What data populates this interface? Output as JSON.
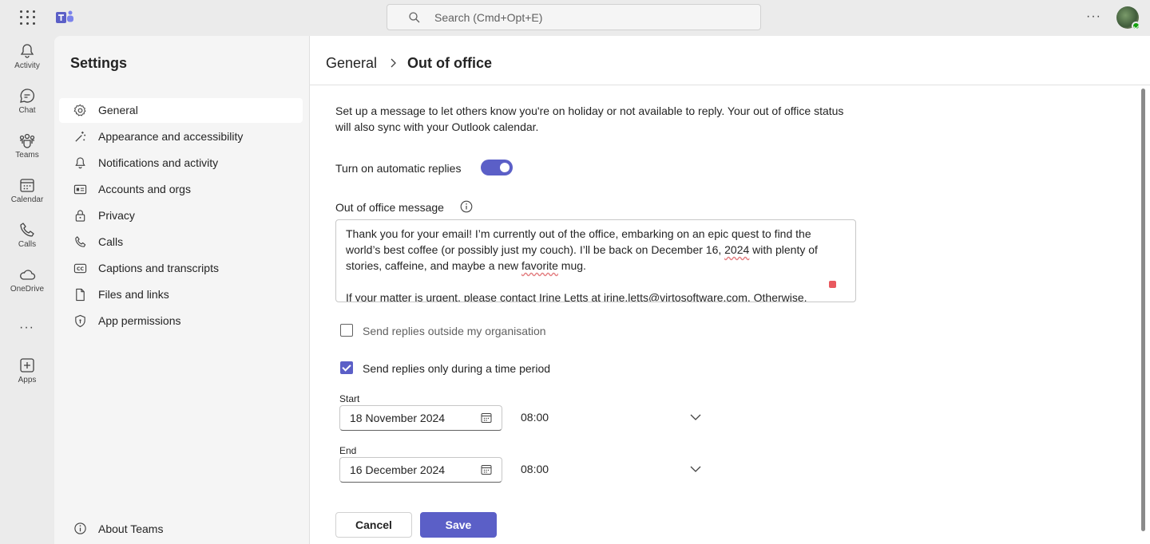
{
  "topbar": {
    "search_placeholder": "Search (Cmd+Opt+E)",
    "more_label": "···"
  },
  "rail": {
    "items": [
      {
        "label": "Activity",
        "icon": "bell-icon"
      },
      {
        "label": "Chat",
        "icon": "chat-icon"
      },
      {
        "label": "Teams",
        "icon": "teams-icon"
      },
      {
        "label": "Calendar",
        "icon": "calendar-icon"
      },
      {
        "label": "Calls",
        "icon": "phone-icon"
      },
      {
        "label": "OneDrive",
        "icon": "cloud-icon"
      },
      {
        "label": "Apps",
        "icon": "add-app-icon"
      }
    ],
    "more_label": "···"
  },
  "settings": {
    "title": "Settings",
    "items": [
      {
        "label": "General",
        "icon": "gear-icon",
        "active": true
      },
      {
        "label": "Appearance and accessibility",
        "icon": "wand-icon"
      },
      {
        "label": "Notifications and activity",
        "icon": "bell-icon"
      },
      {
        "label": "Accounts and orgs",
        "icon": "id-card-icon"
      },
      {
        "label": "Privacy",
        "icon": "lock-icon"
      },
      {
        "label": "Calls",
        "icon": "phone-icon"
      },
      {
        "label": "Captions and transcripts",
        "icon": "cc-icon"
      },
      {
        "label": "Files and links",
        "icon": "file-icon"
      },
      {
        "label": "App permissions",
        "icon": "shield-icon"
      }
    ],
    "about_label": "About Teams"
  },
  "main": {
    "breadcrumb_parent": "General",
    "breadcrumb_current": "Out of office",
    "description": "Set up a message to let others know you're on holiday or not available to reply. Your out of office status will also sync with your Outlook calendar.",
    "auto_reply_label": "Turn on automatic replies",
    "auto_reply_on": true,
    "message_label": "Out of office message",
    "message_part1": "Thank you for your email! I’m currently out of the office, embarking on an epic quest to find the world’s best coffee (or possibly just my couch). I’ll be back on December 16, ",
    "message_year": "2024",
    "message_part2": " with plenty of stories, caffeine, and maybe a new ",
    "message_favorite": "favorite",
    "message_part3": " mug.\n\nIf your matter is urgent, please contact Irine Letts at irine.letts@virtosoftware.com. Otherwise,",
    "outside_org_label": "Send replies outside my organisation",
    "outside_org_checked": false,
    "time_period_label": "Send replies only during a time period",
    "time_period_checked": true,
    "start_label": "Start",
    "start_date": "18 November 2024",
    "start_time": "08:00",
    "end_label": "End",
    "end_date": "16 December 2024",
    "end_time": "08:00",
    "cancel_label": "Cancel",
    "save_label": "Save"
  },
  "colors": {
    "accent": "#5b5fc7",
    "background": "#ebebeb",
    "panel": "#f5f5f5"
  }
}
